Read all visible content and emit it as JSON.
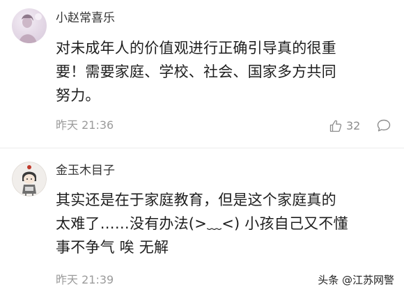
{
  "comments": [
    {
      "username": "小赵常喜乐",
      "content_lines": [
        "对未成年人的价值观进行正确引导真的很重",
        "要！需要家庭、学校、社会、国家多方共同",
        "努力。"
      ],
      "timestamp": "昨天 21:36",
      "like_count": "32",
      "avatar_icon": "user-avatar-icon"
    },
    {
      "username": "金玉木目子",
      "content_lines": [
        "其实还是在于家庭教育，但是这个家庭真的",
        "太难了……没有办法(>﹏<) 小孩自己又不懂",
        "事不争气 唉 无解"
      ],
      "timestamp": "昨天 21:39",
      "avatar_icon": "user-avatar-icon"
    }
  ],
  "watermark": "头条 @江苏网警",
  "colors": {
    "text": "#1e1e1e",
    "muted": "#9b9b9b",
    "divider": "#ececec"
  }
}
